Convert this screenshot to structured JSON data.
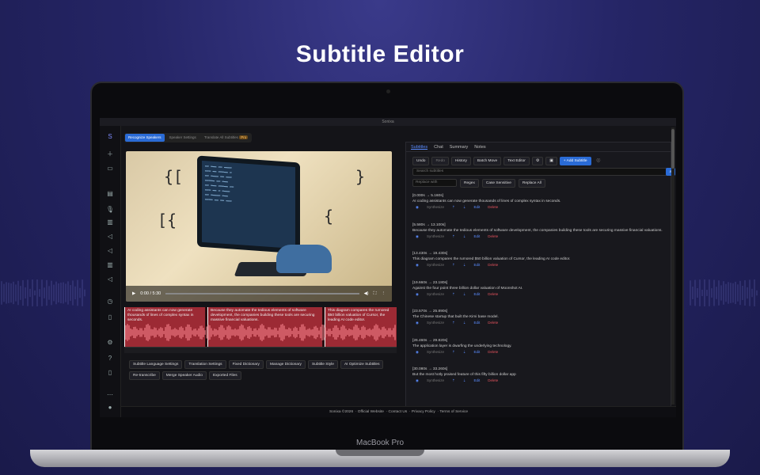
{
  "headline": "Subtitle Editor",
  "device_label": "MacBook Pro",
  "window": {
    "title": "Sonixa"
  },
  "mode_tabs": [
    {
      "label": "Recognize Speakers",
      "active": true
    },
    {
      "label": "Speaker Settings",
      "active": false
    },
    {
      "label": "Translate All Subtitles",
      "active": false
    }
  ],
  "mode_badge": "Pro",
  "video": {
    "time": "0:00 / 5:30"
  },
  "waveform_segments": [
    "AI coding assistants can now generate thousands of lines of complex syntax in seconds.",
    "Because they automate the tedious elements of software development, the companies building these tools are securing massive financial valuations.",
    "This diagram compares the rumored $50 billion valuation of Cursor, the leading AI code editor."
  ],
  "toolbar": [
    "Subtitle Language Settings",
    "Translation Settings",
    "Fixed Dictionary",
    "Manage Dictionary",
    "Subtitle Style",
    "AI Optimize Subtitles",
    "Re-transcribe",
    "Merge Speaker Audio",
    "Exported Files"
  ],
  "right_tabs": [
    {
      "label": "Subtitles",
      "active": true
    },
    {
      "label": "Chat",
      "active": false
    },
    {
      "label": "Summary",
      "active": false
    },
    {
      "label": "Notes",
      "active": false
    }
  ],
  "actions": {
    "undo": "Undo",
    "redo": "Redo",
    "history": "History",
    "batch_move": "Batch Move",
    "text_editor": "Text Editor",
    "add_subtitle": "+ Add Subtitle"
  },
  "search": {
    "placeholder": "Search subtitles"
  },
  "replace": {
    "placeholder": "Replace with",
    "regex": "Regex",
    "case": "Case Sensitive",
    "replace_all": "Replace All"
  },
  "item_actions": {
    "synthesize": "Synthesize",
    "edit": "Edit",
    "delete": "Delete"
  },
  "subtitles": [
    {
      "time": "[0.000s → 5.160s]",
      "text": "AI coding assistants can now generate thousands of lines of complex syntax in seconds."
    },
    {
      "time": "[5.580s → 13.100s]",
      "text": "Because they automate the tedious elements of software development, the companies building these tools are securing massive financial valuations."
    },
    {
      "time": "[13.430s → 19.430s]",
      "text": "This diagram compares the rumored $50 billion valuation of Cursor, the leading AI code editor."
    },
    {
      "time": "[19.660s → 23.180s]",
      "text": "Against the four point three billion dollar valuation of Moonshot AI."
    },
    {
      "time": "[23.570s → 25.890s]",
      "text": "The Chinese startup that built the Kimi base model."
    },
    {
      "time": "[26.460s → 29.820s]",
      "text": "The application layer is dwarfing the underlying technology."
    },
    {
      "time": "[30.080s → 33.260s]",
      "text": "But the most hotly praised feature of this fifty billion dollar app"
    }
  ],
  "footer": {
    "copyright": "Sonixa ©2026",
    "links": [
      "Official Website",
      "Contact Us",
      "Privacy Policy",
      "Terms of Service"
    ]
  },
  "colors": {
    "accent": "#2a6bd6",
    "waveform": "#9c2a34",
    "delete": "#e2525c"
  }
}
